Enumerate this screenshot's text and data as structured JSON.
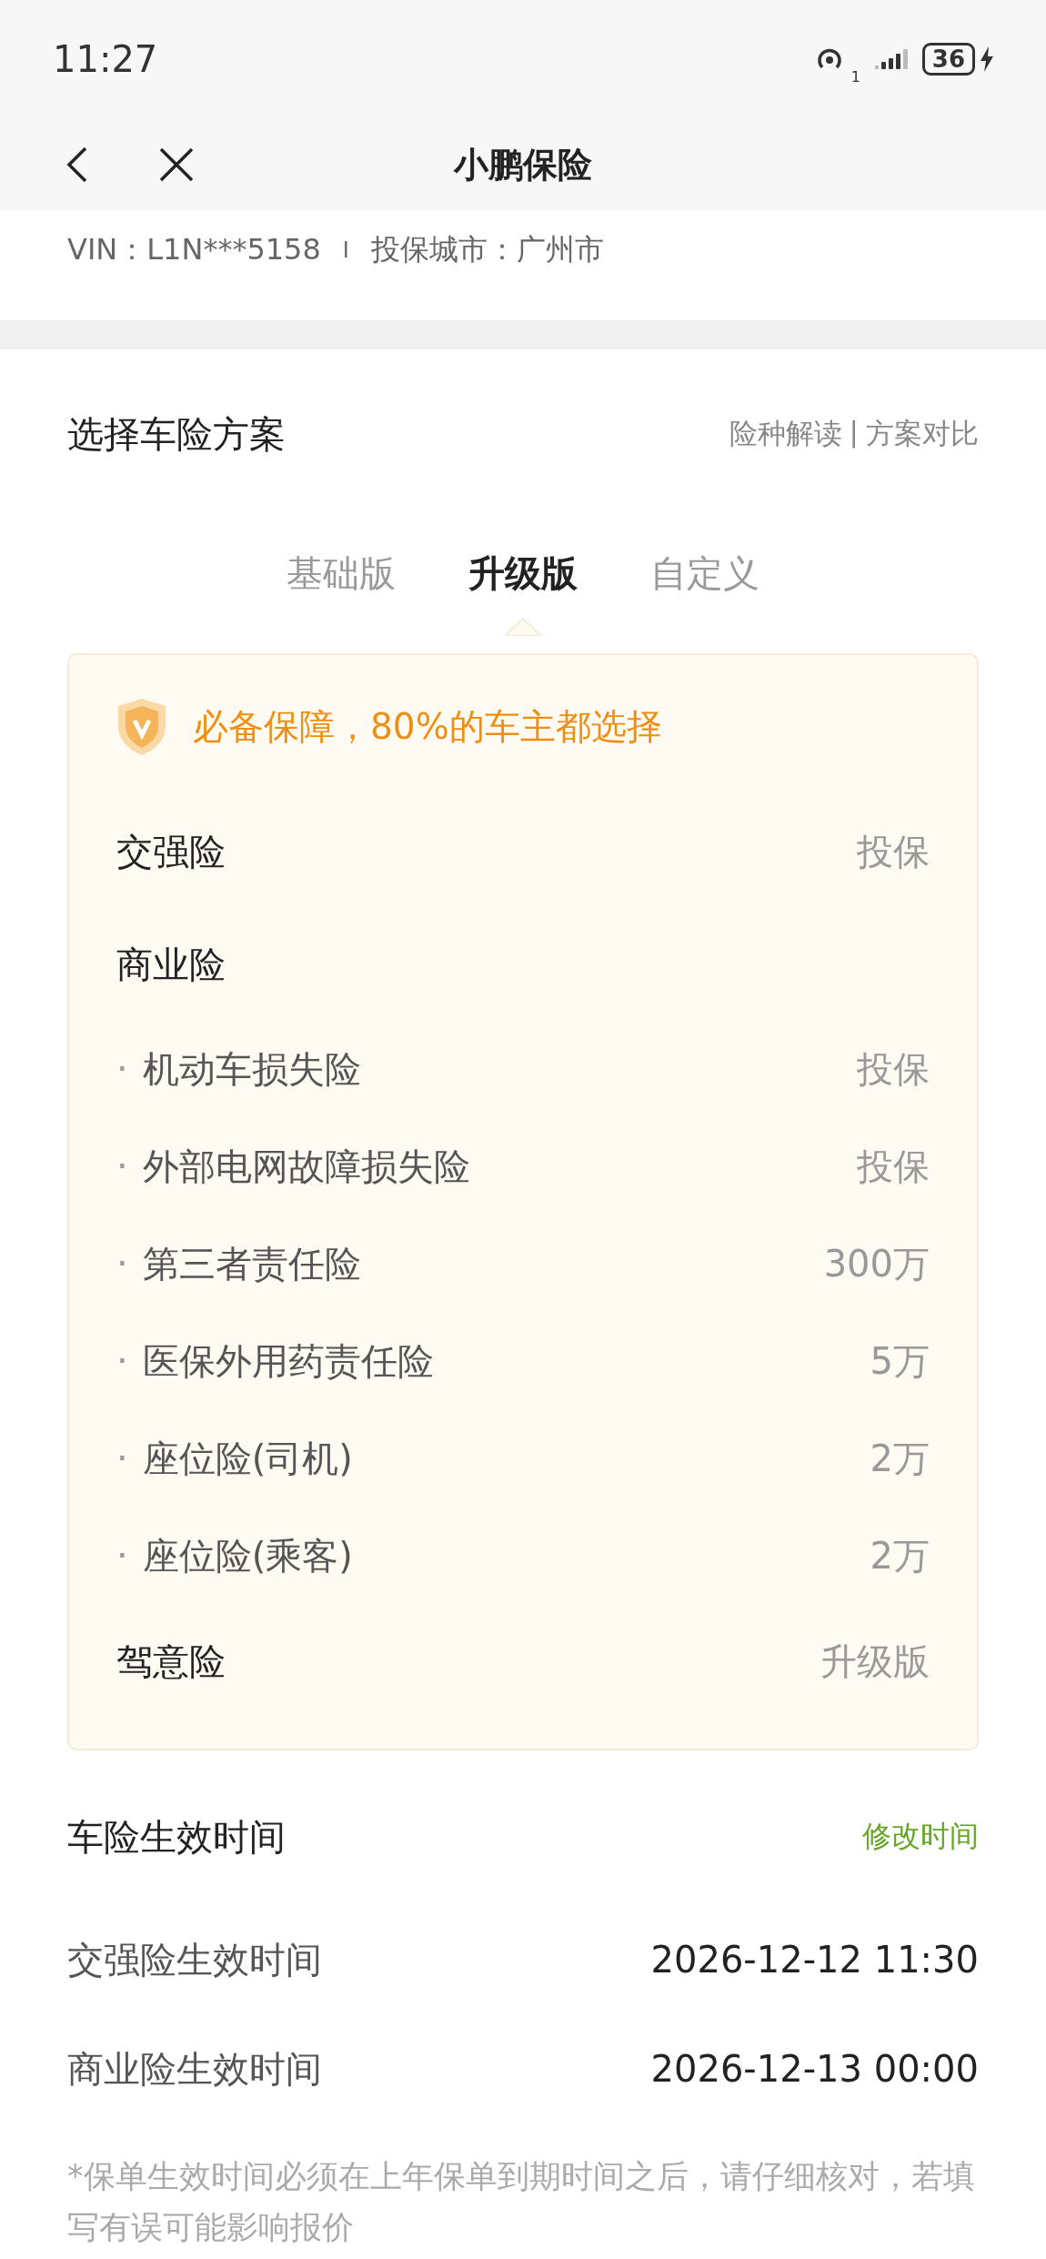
{
  "status_bar": {
    "time": "11:27",
    "hotspot_badge": "1",
    "battery": "36",
    "charging": true
  },
  "nav": {
    "title": "小鹏保险"
  },
  "vehicle": {
    "vin_label": "VIN：",
    "vin": "L1N***5158",
    "separator": "I",
    "city_label": "投保城市：",
    "city": "广州市"
  },
  "plan": {
    "title": "选择车险方案",
    "links": [
      {
        "label": "险种解读"
      },
      {
        "label": "方案对比"
      }
    ],
    "link_separator": "|",
    "tabs": [
      {
        "label": "基础版",
        "selected": false
      },
      {
        "label": "升级版",
        "selected": true
      },
      {
        "label": "自定义",
        "selected": false
      }
    ],
    "banner": "必备保障，80%的车主都选择",
    "items": [
      {
        "kind": "main",
        "name": "交强险",
        "value": "投保"
      },
      {
        "kind": "main",
        "name": "商业险"
      },
      {
        "kind": "sub",
        "bullet": "·",
        "name": "机动车损失险",
        "value": "投保"
      },
      {
        "kind": "sub",
        "bullet": "·",
        "name": "外部电网故障损失险",
        "value": "投保"
      },
      {
        "kind": "sub",
        "bullet": "·",
        "name": "第三者责任险",
        "value": "300万"
      },
      {
        "kind": "sub",
        "bullet": "·",
        "name": "医保外用药责任险",
        "value": "5万"
      },
      {
        "kind": "sub",
        "bullet": "·",
        "name": "座位险(司机)",
        "value": "2万"
      },
      {
        "kind": "sub",
        "bullet": "·",
        "name": "座位险(乘客)",
        "value": "2万"
      },
      {
        "kind": "main",
        "name": "驾意险",
        "value": "升级版"
      }
    ]
  },
  "effective": {
    "title": "车险生效时间",
    "action": "修改时间",
    "rows": [
      {
        "label": "交强险生效时间",
        "value": "2026-12-12 11:30"
      },
      {
        "label": "商业险生效时间",
        "value": "2026-12-13 00:00"
      }
    ],
    "note": "*保单生效时间必须在上年保单到期时间之后，请仔细核对，若填写有误可能影响报价"
  }
}
